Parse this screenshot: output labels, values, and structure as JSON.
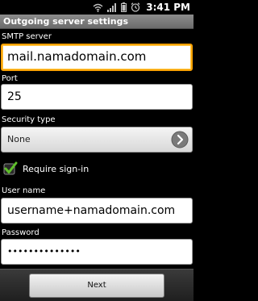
{
  "status_bar": {
    "time": "3:41 PM",
    "icons": [
      "wifi-icon",
      "signal-icon",
      "battery-icon",
      "alarm-icon"
    ]
  },
  "header": {
    "title": "Outgoing server settings"
  },
  "form": {
    "smtp_server": {
      "label": "SMTP server",
      "value": "mail.namadomain.com"
    },
    "port": {
      "label": "Port",
      "value": "25"
    },
    "security_type": {
      "label": "Security type",
      "selected": "None"
    },
    "require_signin": {
      "label": "Require sign-in",
      "checked": true
    },
    "username": {
      "label": "User name",
      "value": "username+namadomain.com"
    },
    "password": {
      "label": "Password",
      "value": "••••••••••••••"
    }
  },
  "footer": {
    "next_label": "Next"
  },
  "colors": {
    "focus_border": "#f8a000",
    "check_green": "#5fbf2a",
    "background": "#000000"
  }
}
